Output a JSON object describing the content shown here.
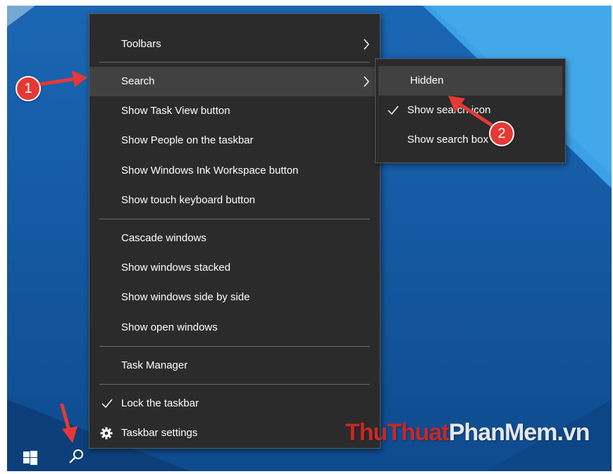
{
  "main_menu": {
    "items": [
      {
        "label": "Toolbars",
        "submenu": true
      },
      {
        "label": "Search",
        "submenu": true,
        "highlighted": true
      },
      {
        "label": "Show Task View button"
      },
      {
        "label": "Show People on the taskbar"
      },
      {
        "label": "Show Windows Ink Workspace button"
      },
      {
        "label": "Show touch keyboard button"
      },
      {
        "label": "Cascade windows"
      },
      {
        "label": "Show windows stacked"
      },
      {
        "label": "Show windows side by side"
      },
      {
        "label": "Show open windows"
      },
      {
        "label": "Task Manager"
      },
      {
        "label": "Lock the taskbar",
        "checked": true
      },
      {
        "label": "Taskbar settings",
        "icon": "gear-icon"
      }
    ]
  },
  "search_submenu": {
    "items": [
      {
        "label": "Hidden",
        "highlighted": true
      },
      {
        "label": "Show search icon",
        "checked": true
      },
      {
        "label": "Show search box"
      }
    ]
  },
  "annotations": {
    "badge_1": "1",
    "badge_2": "2",
    "arrow_color": "#e53935"
  },
  "taskbar": {
    "icons": [
      "windows-start-icon",
      "search-icon"
    ]
  },
  "watermark": {
    "part1": "ThuThuat",
    "part2": "PhanMem",
    "part3": ".vn"
  },
  "colors": {
    "menu_bg": "#2b2b2b",
    "menu_highlight": "#414141",
    "desktop_blue": "#1b66b3",
    "accent_light_blue": "#3aa0e8"
  }
}
